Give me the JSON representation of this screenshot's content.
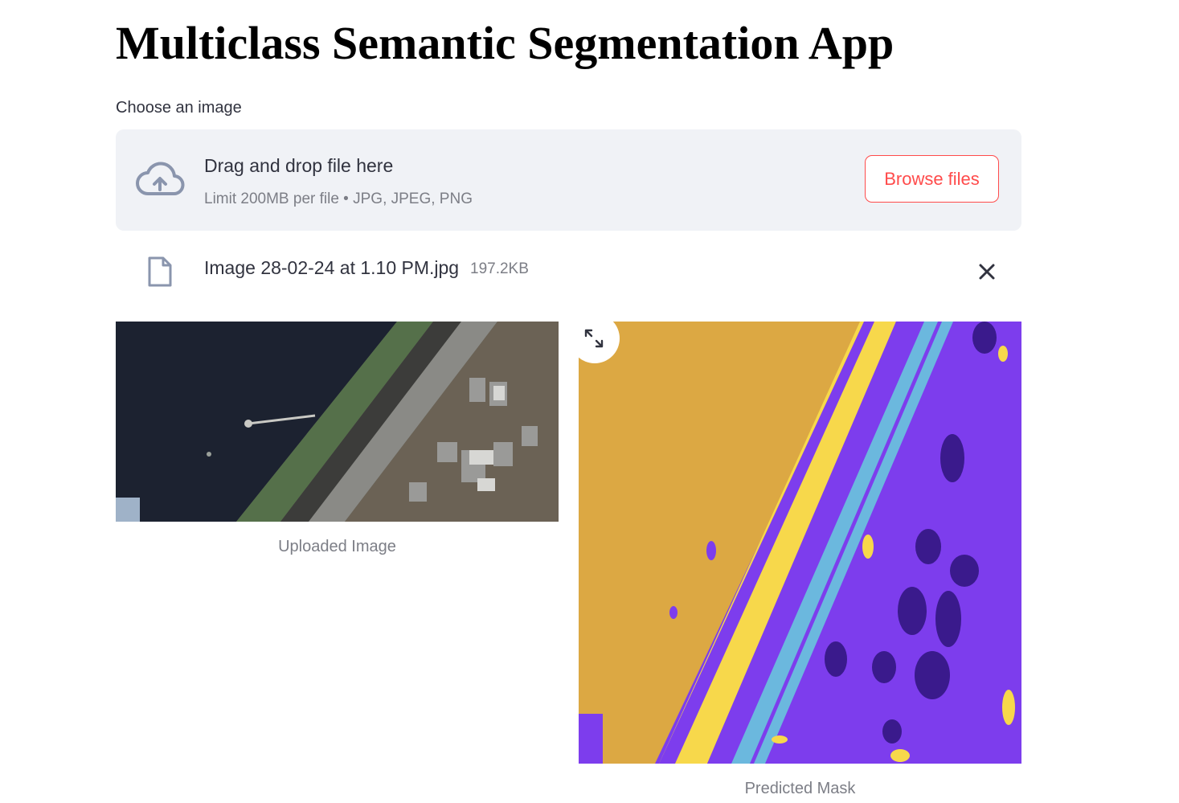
{
  "page": {
    "title": "Multiclass Semantic Segmentation App"
  },
  "uploader": {
    "label": "Choose an image",
    "drop_text": "Drag and drop file here",
    "limit_text": "Limit 200MB per file • JPG, JPEG, PNG",
    "browse_label": "Browse files",
    "icon": "cloud-upload-icon"
  },
  "uploaded_file": {
    "name": "Image 28-02-24 at 1.10 PM.jpg",
    "size": "197.2KB",
    "icon": "file-icon",
    "remove_icon": "close-icon"
  },
  "results": {
    "uploaded_caption": "Uploaded Image",
    "mask_caption": "Predicted Mask",
    "fullscreen_icon": "expand-icon"
  },
  "colors": {
    "accent": "#ff4b4b",
    "dropzone_bg": "#f0f2f6",
    "text": "#31333f",
    "muted_text": "#7c7e86",
    "mask_land": "#dca843",
    "mask_building": "#7d3ded",
    "mask_vegetation": "#f7d84b",
    "mask_road": "#6bb8de",
    "mask_dark": "#3a1a8c"
  }
}
